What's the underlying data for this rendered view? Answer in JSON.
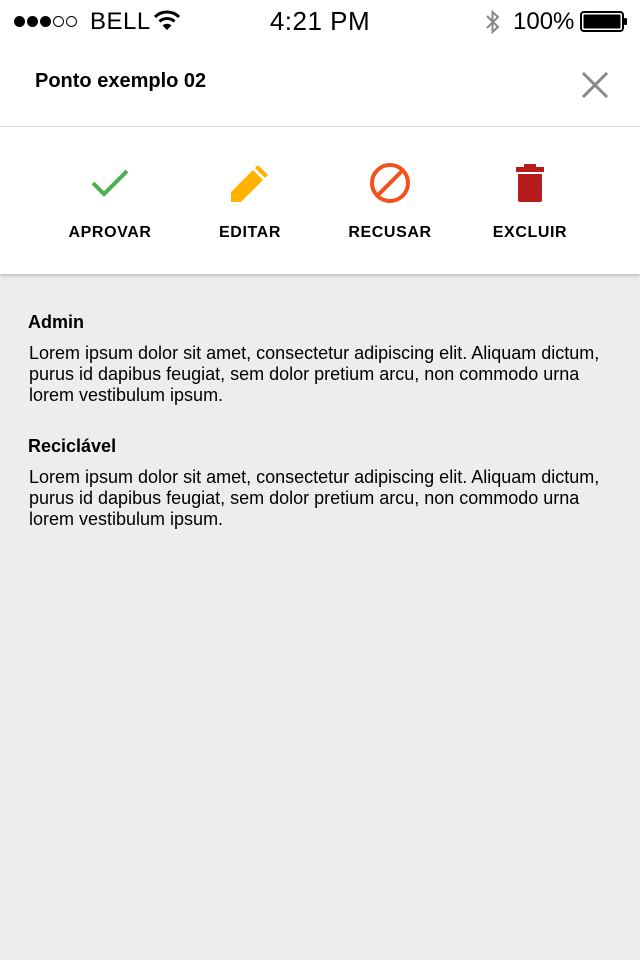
{
  "status_bar": {
    "carrier": "BELL",
    "time": "4:21 PM",
    "battery": "100%",
    "signal_bars_filled": 3,
    "signal_bars_total": 5
  },
  "header": {
    "title": "Ponto exemplo 02"
  },
  "actions": [
    {
      "label": "APROVAR",
      "icon": "check-icon",
      "color": "#4caf50"
    },
    {
      "label": "EDITAR",
      "icon": "pencil-icon",
      "color": "#ffb300"
    },
    {
      "label": "RECUSAR",
      "icon": "block-icon",
      "color": "#f4511e"
    },
    {
      "label": "EXCLUIR",
      "icon": "trash-icon",
      "color": "#b71c1c"
    }
  ],
  "sections": [
    {
      "title": "Admin",
      "text": "Lorem ipsum dolor sit amet, consectetur adipiscing elit. Aliquam dictum, purus id dapibus feugiat, sem dolor pretium arcu, non commodo urna lorem vestibulum ipsum."
    },
    {
      "title": "Reciclável",
      "text": "Lorem ipsum dolor sit amet, consectetur adipiscing elit. Aliquam dictum, purus id dapibus feugiat, sem dolor pretium arcu, non commodo urna lorem vestibulum ipsum."
    }
  ]
}
